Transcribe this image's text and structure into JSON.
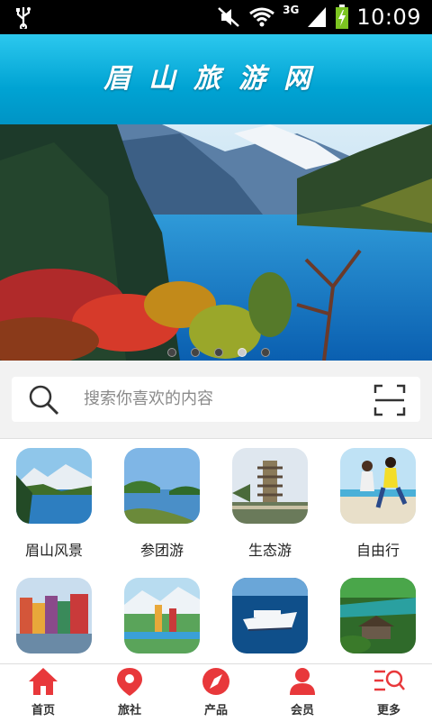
{
  "status_bar": {
    "time": "10:09",
    "network": "3G"
  },
  "header": {
    "title": "眉山旅游网"
  },
  "banner": {
    "slides": 5,
    "active_slide": 4
  },
  "search": {
    "placeholder": "搜索你喜欢的内容"
  },
  "categories": [
    {
      "label": "眉山风景",
      "icon": "mountain-lake-photo"
    },
    {
      "label": "参团游",
      "icon": "lake-island-photo"
    },
    {
      "label": "生态游",
      "icon": "pagoda-photo"
    },
    {
      "label": "自由行",
      "icon": "beach-couple-photo"
    },
    {
      "label": "",
      "icon": "colorful-town-photo"
    },
    {
      "label": "",
      "icon": "tourists-photo"
    },
    {
      "label": "",
      "icon": "cruise-ship-photo"
    },
    {
      "label": "",
      "icon": "green-village-photo"
    }
  ],
  "tabs": [
    {
      "label": "首页",
      "icon": "home-icon"
    },
    {
      "label": "旅社",
      "icon": "location-pin-icon"
    },
    {
      "label": "产品",
      "icon": "compass-icon"
    },
    {
      "label": "会员",
      "icon": "person-icon"
    },
    {
      "label": "更多",
      "icon": "menu-search-icon"
    }
  ],
  "colors": {
    "accent": "#e8383b",
    "header": "#00a3d3"
  }
}
